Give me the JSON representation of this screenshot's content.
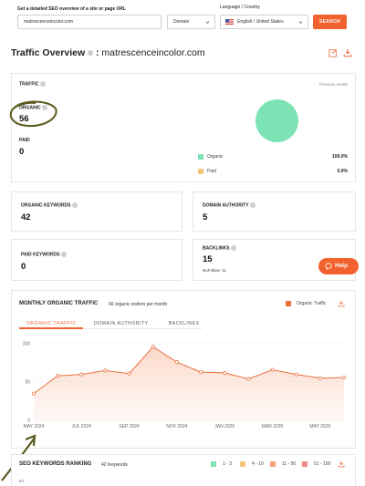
{
  "search": {
    "label": "Get a detailed SEO overview of a site or page URL",
    "value": "matrescenceincolor.com",
    "scope": "Domain",
    "lang_label": "Language / Country",
    "lang_value": "English / United States",
    "button": "SEARCH"
  },
  "header": {
    "title": "Traffic Overview",
    "sep": " : ",
    "domain": "matrescenceincolor.com",
    "icons": [
      "edit-icon",
      "download-icon"
    ]
  },
  "traffic": {
    "label": "TRAFFIC",
    "period": "Previous month",
    "organic_label": "ORGANIC",
    "organic_value": "56",
    "paid_label": "PAID",
    "paid_value": "0",
    "legend": [
      {
        "name": "Organic",
        "value": "100.0%",
        "color": "#7de3b5"
      },
      {
        "name": "Paid",
        "value": "0.0%",
        "color": "#f5c77a"
      }
    ]
  },
  "stats": {
    "organic_keywords_label": "ORGANIC KEYWORDS",
    "organic_keywords_value": "42",
    "domain_authority_label": "DOMAIN AUTHORITY",
    "domain_authority_value": "5",
    "paid_keywords_label": "PAID KEYWORDS",
    "paid_keywords_value": "0",
    "backlinks_label": "BACKLINKS",
    "backlinks_value": "15",
    "nofollow": "NoFollow: 11"
  },
  "help": {
    "label": "Help"
  },
  "monthly": {
    "title": "MONTHLY ORGANIC TRAFFIC",
    "subtitle": "56 organic visitors per month",
    "legend": "Organic Traffic",
    "tabs": [
      "ORGANIC TRAFFIC",
      "DOMAIN AUTHORITY",
      "BACKLINKS"
    ]
  },
  "chart_data": {
    "type": "area",
    "x": [
      "MAY 2024",
      "JUN 2024",
      "JUL 2024",
      "AUG 2024",
      "SEP 2024",
      "OCT 2024",
      "NOV 2024",
      "DEC 2024",
      "JAN 2025",
      "FEB 2025",
      "MAR 2025",
      "APR 2025",
      "MAY 2025",
      "JUN 2025"
    ],
    "xticks": [
      "MAY 2024",
      "JUL 2024",
      "SEP 2024",
      "NOV 2024",
      "JAN 2025",
      "MAR 2025",
      "MAY 2025"
    ],
    "series": [
      {
        "name": "Organic Traffic",
        "values": [
          35,
          58,
          60,
          65,
          61,
          96,
          76,
          63,
          62,
          54,
          66,
          60,
          55,
          56
        ]
      }
    ],
    "ylim": [
      0,
      100
    ],
    "yticks": [
      0,
      50,
      100
    ],
    "color": "#e8703f"
  },
  "ranking": {
    "title": "SEO KEYWORDS RANKING",
    "count": "42 Keywords",
    "y_top": "80",
    "legend": [
      {
        "name": "1 - 3",
        "color": "#7de3b5"
      },
      {
        "name": "4 - 10",
        "color": "#f5c77a"
      },
      {
        "name": "11 - 50",
        "color": "#f5a27a"
      },
      {
        "name": "51 - 100",
        "color": "#e88b8b"
      }
    ]
  }
}
